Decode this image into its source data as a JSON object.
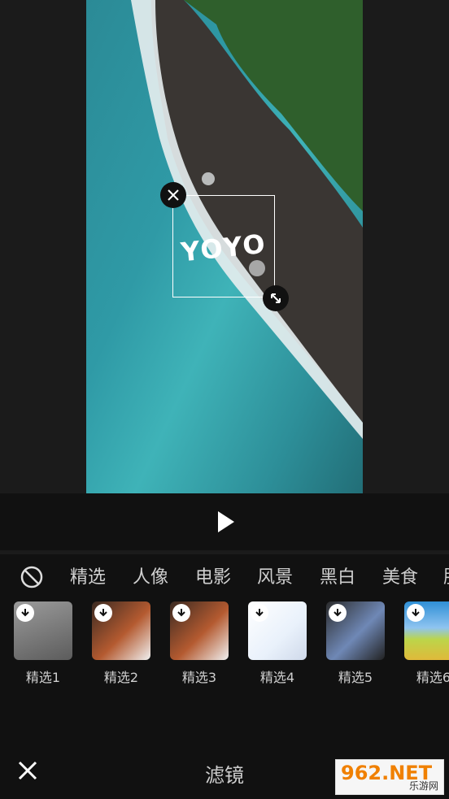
{
  "sticker": {
    "text": "YOYO"
  },
  "categories": {
    "items": [
      "精选",
      "人像",
      "电影",
      "风景",
      "黑白",
      "美食",
      "肌"
    ]
  },
  "filters": {
    "items": [
      {
        "label": "精选1",
        "colors": [
          "#8a8a8a",
          "#e6e6e6"
        ]
      },
      {
        "label": "精选2",
        "colors": [
          "#b45a30",
          "#f0f0f0"
        ]
      },
      {
        "label": "精选3",
        "colors": [
          "#b45a30",
          "#f0f0f0"
        ]
      },
      {
        "label": "精选4",
        "colors": [
          "#e9f1fb",
          "#ffffff"
        ]
      },
      {
        "label": "精选5",
        "colors": [
          "#6f88b6",
          "#2b2b2b"
        ]
      },
      {
        "label": "精选6",
        "colors": [
          "#bcd54a",
          "#2f8fd6"
        ]
      }
    ]
  },
  "bottom": {
    "title": "滤镜"
  },
  "watermark": {
    "main": "962.NET",
    "sub": "乐游网"
  }
}
